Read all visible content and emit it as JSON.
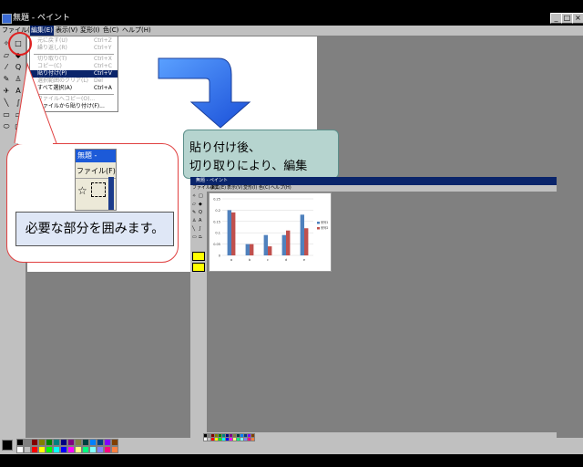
{
  "window": {
    "title": "無題 - ペイント",
    "buttons": [
      "_",
      "□",
      "×"
    ]
  },
  "menubar": {
    "items": [
      "ファイル(F)",
      "編集(E)",
      "表示(V)",
      "変形(I)",
      "色(C)",
      "ヘルプ(H)"
    ],
    "active_index": 1
  },
  "edit_menu": {
    "items": [
      {
        "label": "元に戻す(U)",
        "shortcut": "Ctrl+Z",
        "enabled": false
      },
      {
        "label": "繰り返し(R)",
        "shortcut": "Ctrl+Y",
        "enabled": false
      },
      {
        "label": "切り取り(T)",
        "shortcut": "Ctrl+X",
        "enabled": false
      },
      {
        "label": "コピー(C)",
        "shortcut": "Ctrl+C",
        "enabled": false
      },
      {
        "label": "貼り付け(P)",
        "shortcut": "Ctrl+V",
        "enabled": true,
        "selected": true
      },
      {
        "label": "選択範囲のクリア(L)",
        "shortcut": "Del",
        "enabled": false
      },
      {
        "label": "すべて選択(A)",
        "shortcut": "Ctrl+A",
        "enabled": true
      },
      {
        "label": "ファイルへコピー(O)...",
        "shortcut": "",
        "enabled": false
      },
      {
        "label": "ファイルから貼り付け(F)...",
        "shortcut": "",
        "enabled": true
      }
    ]
  },
  "annotations": {
    "zoom_title": "無題 -",
    "zoom_menu": "ファイル(F)",
    "instruction": "必要な部分を囲みます。",
    "after_paste_line1": "貼り付け後、",
    "after_paste_line2": "切り取りにより、編集"
  },
  "inset_window": {
    "title": "無題 - ペイント",
    "menu": [
      "ファイル(F)",
      "編集(E)",
      "表示(V)",
      "変形(I)",
      "色(C)",
      "ヘルプ(H)"
    ]
  },
  "palette_colors": [
    "#000000",
    "#808080",
    "#800000",
    "#808000",
    "#008000",
    "#008080",
    "#000080",
    "#800080",
    "#808040",
    "#004040",
    "#0080ff",
    "#004080",
    "#8000ff",
    "#804000",
    "#ffffff",
    "#c0c0c0",
    "#ff0000",
    "#ffff00",
    "#00ff00",
    "#00ffff",
    "#0000ff",
    "#ff00ff",
    "#ffff80",
    "#00ff80",
    "#80ffff",
    "#8080ff",
    "#ff0080",
    "#ff8040"
  ],
  "chart_data": {
    "type": "bar",
    "categories": [
      "a",
      "b",
      "c",
      "d",
      "e"
    ],
    "series": [
      {
        "name": "系列1",
        "color": "#4f81bd",
        "values": [
          0.2,
          0.05,
          0.09,
          0.09,
          0.18
        ]
      },
      {
        "name": "系列2",
        "color": "#c0504d",
        "values": [
          0.19,
          0.05,
          0.04,
          0.11,
          0.12
        ]
      }
    ],
    "ylim": [
      0,
      0.25
    ],
    "yticks": [
      "0.25",
      "0.2",
      "0.15",
      "0.1",
      "0.05",
      "0"
    ],
    "legend": "right",
    "grid": true
  }
}
